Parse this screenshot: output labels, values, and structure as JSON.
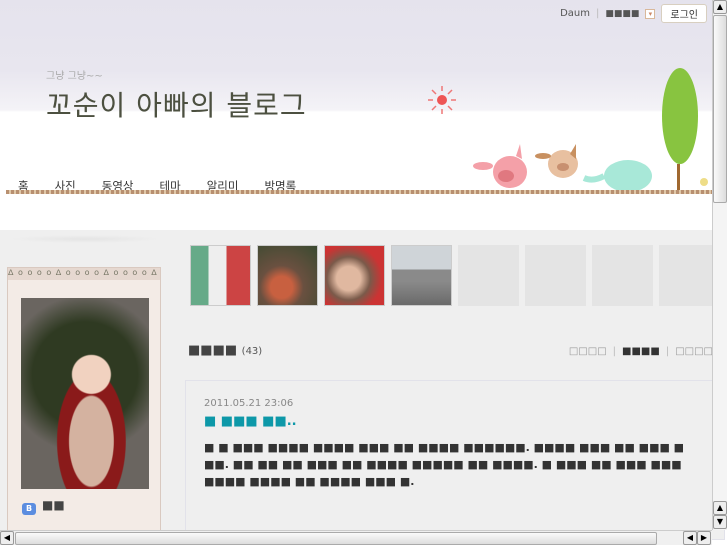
{
  "topbar": {
    "daum": "Daum",
    "menu_label": "■■■■",
    "dropdown": "▾",
    "login": "로그인"
  },
  "header": {
    "subtitle": "그냥 그냥~~",
    "title": "꼬순이 아빠의 블로그"
  },
  "nav": [
    {
      "label": "홈"
    },
    {
      "label": "사진"
    },
    {
      "label": "동영상"
    },
    {
      "label": "테마"
    },
    {
      "label": "알리미"
    },
    {
      "label": "방명록"
    }
  ],
  "sidebar": {
    "rings": "ᐃ o o o o ᐃ o o o o ᐃ o o o o ᐃ o o",
    "blog_icon": "B",
    "blog_name": "■■"
  },
  "section": {
    "title": "■■■■",
    "count": "(43)",
    "views": [
      "□□□□",
      "■■■■",
      "□□□□"
    ]
  },
  "post": {
    "date": "2011.05.21 23:06",
    "title": "■ ■■■ ■■..",
    "body": "■ ■ ■■■ ■■■■ ■■■■ ■■■ ■■ ■■■■ ■■■■■■. ■■■■ ■■■ ■■ ■■■ ■ ■■. ■■ ■■ ■■ ■■■ ■■ ■■■■ ■■■■■ ■■ ■■■■. ■ ■■■ ■■ ■■■ ■■■ ■■■■ ■■■■ ■■ ■■■■ ■■■ ■."
  },
  "scroll": {
    "up": "▲",
    "down": "▼",
    "left": "◀",
    "right": "▶"
  }
}
